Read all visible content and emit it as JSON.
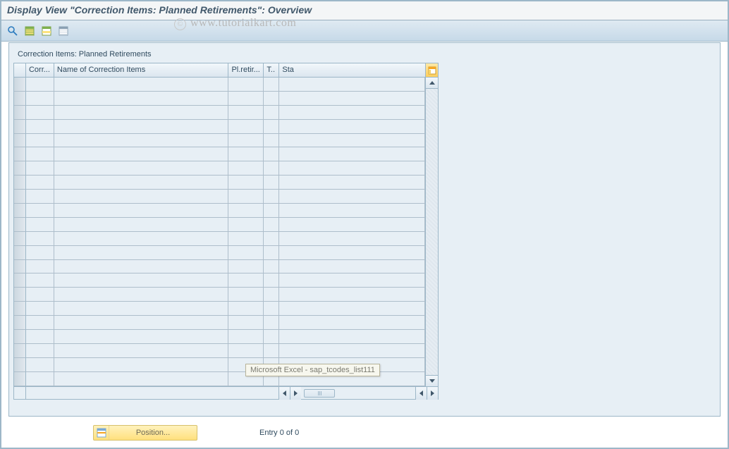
{
  "title": "Display View \"Correction Items: Planned Retirements\": Overview",
  "watermark": "www.tutorialkart.com",
  "toolbar": {
    "btn_details": "Details",
    "btn_select_all": "Select All",
    "btn_select_block": "Select Block",
    "btn_deselect_all": "Deselect All"
  },
  "panel": {
    "caption": "Correction Items: Planned Retirements"
  },
  "columns": {
    "c1": "Corr...",
    "c2": "Name of Correction Items",
    "c3": "Pl.retir...",
    "c4": "T..",
    "c5": "Sta"
  },
  "tooltip": "Microsoft Excel - sap_tcodes_list111",
  "footer": {
    "position_label": "Position...",
    "entry_text": "Entry 0 of 0"
  },
  "colors": {
    "accent": "#41586b",
    "grid_border": "#9db7c8",
    "yellow": "#ffe07d"
  }
}
